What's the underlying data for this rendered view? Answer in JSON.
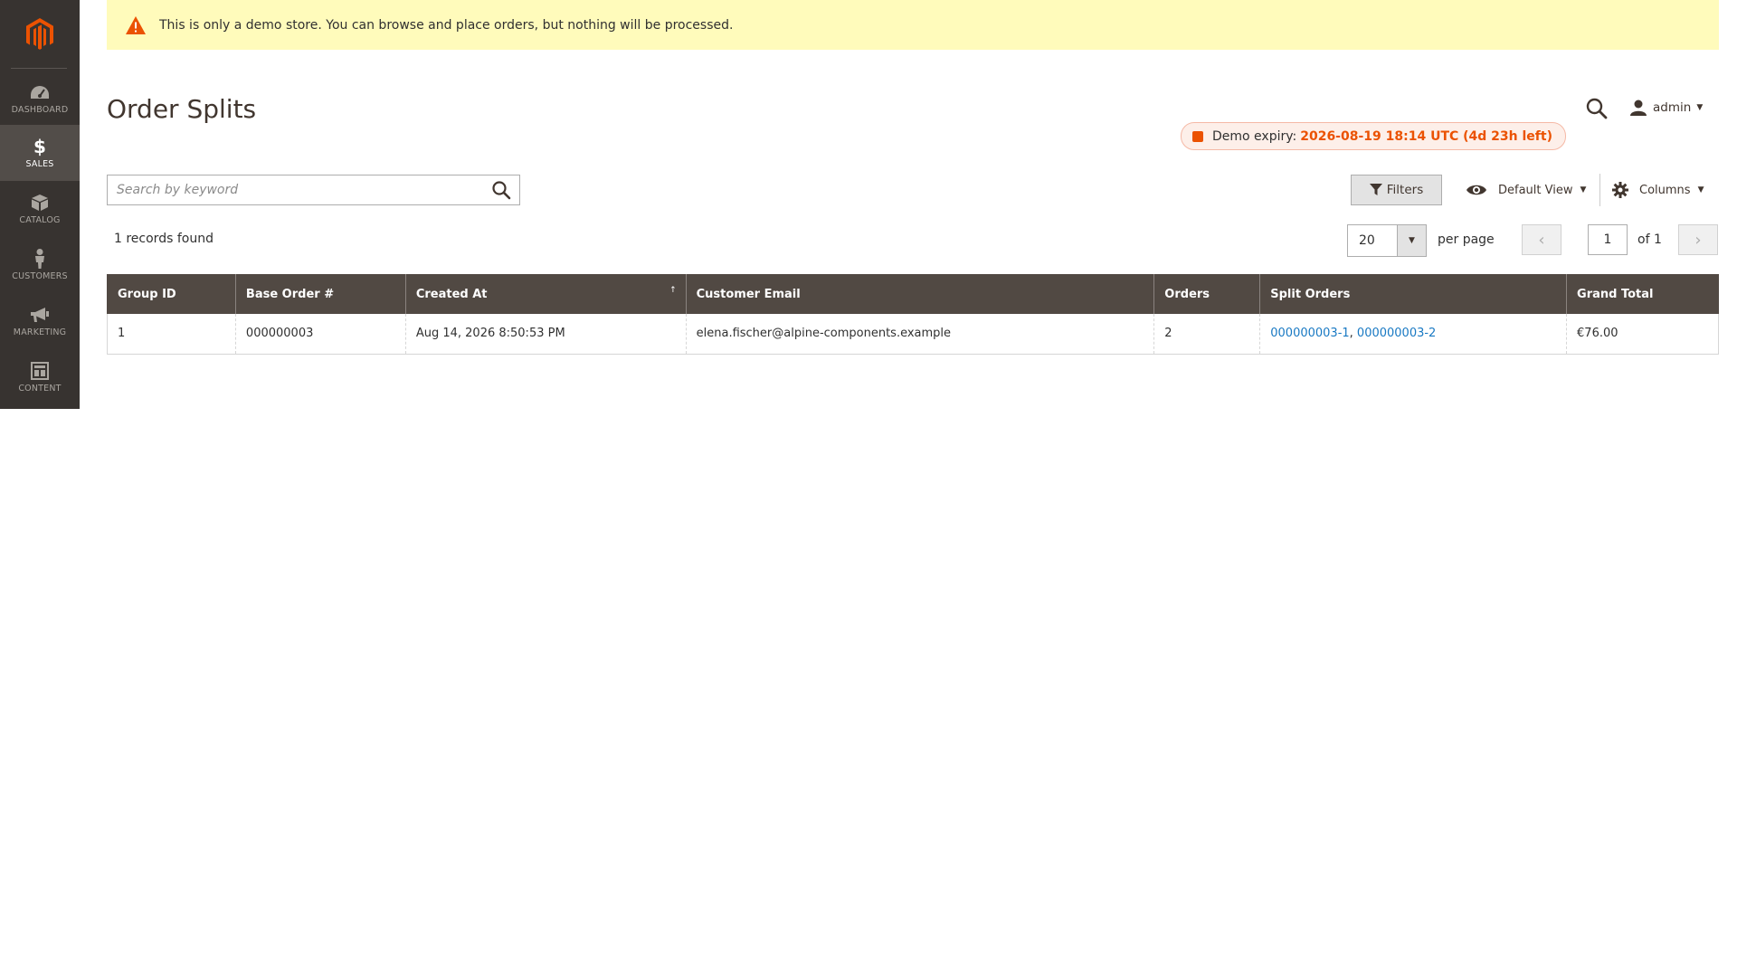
{
  "notice": {
    "text": "This is only a demo store. You can browse and place orders, but nothing will be processed."
  },
  "sidebar": {
    "logo_icon": "magento-logo-icon",
    "items": [
      {
        "label": "DASHBOARD",
        "icon": "speedometer-icon",
        "active": false
      },
      {
        "label": "SALES",
        "icon": "dollar-icon",
        "active": true
      },
      {
        "label": "CATALOG",
        "icon": "box-icon",
        "active": false
      },
      {
        "label": "CUSTOMERS",
        "icon": "person-icon",
        "active": false
      },
      {
        "label": "MARKETING",
        "icon": "megaphone-icon",
        "active": false
      },
      {
        "label": "CONTENT",
        "icon": "layout-icon",
        "active": false
      }
    ]
  },
  "header": {
    "title": "Order Splits",
    "user": "admin",
    "demo_expiry": {
      "label": "Demo expiry:",
      "value": "2026-08-19 18:14 UTC (4d 23h left)"
    }
  },
  "toolbar": {
    "search_placeholder": "Search by keyword",
    "filters_label": "Filters",
    "view_label": "Default View",
    "columns_label": "Columns"
  },
  "listing": {
    "records_found": "1 records found",
    "per_page_value": "20",
    "per_page_label": "per page",
    "current_page": "1",
    "page_of": "of 1"
  },
  "table": {
    "columns": [
      "Group ID",
      "Base Order #",
      "Created At",
      "Customer Email",
      "Orders",
      "Split Orders",
      "Grand Total"
    ],
    "sort_indicator": "↑",
    "rows": [
      {
        "group_id": "1",
        "base_order": "000000003",
        "created_at": "Aug 14, 2026 8:50:53 PM",
        "email": "elena.fischer@alpine-components.example",
        "orders": "2",
        "split_order_1": "000000003-1",
        "split_separator": ", ",
        "split_order_2": "000000003-2",
        "grand_total": "€76.00"
      }
    ]
  },
  "colors": {
    "sidebar": "#373330",
    "header_row": "#514943",
    "accent": "#eb5202",
    "link": "#1979c3",
    "notice": "#fffbbb"
  }
}
